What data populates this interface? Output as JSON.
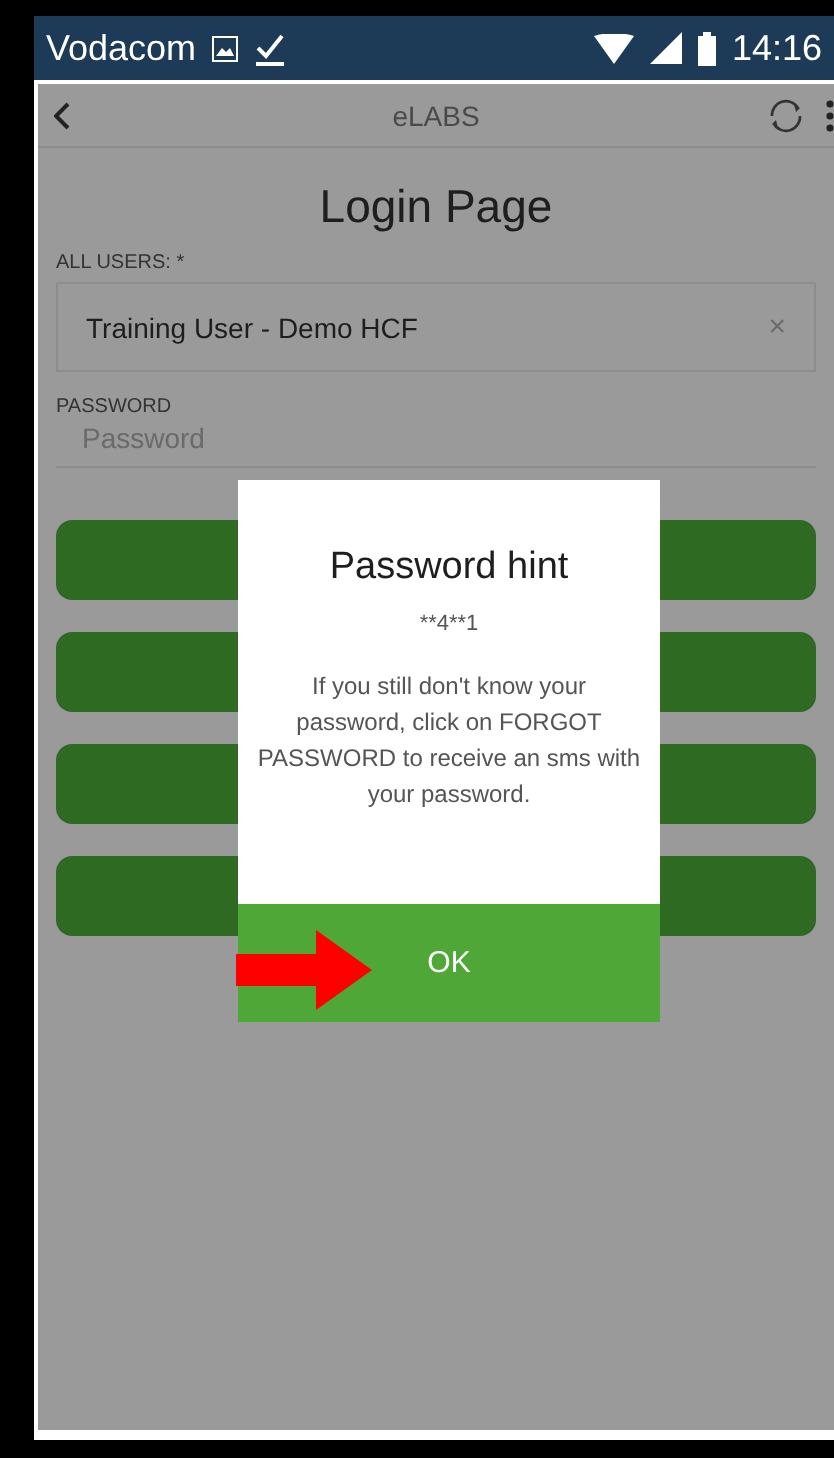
{
  "status_bar": {
    "carrier": "Vodacom",
    "time": "14:16"
  },
  "app_bar": {
    "title": "eLABS"
  },
  "heading": "Login Page",
  "users_field": {
    "label": "ALL USERS: *",
    "value": "Training User - Demo HCF",
    "clear": "×"
  },
  "password_field": {
    "label": "PASSWORD",
    "placeholder": "Password"
  },
  "action_buttons": [
    {
      "kind": "filled"
    },
    {
      "kind": "filled"
    },
    {
      "kind": "filled"
    },
    {
      "kind": "filled"
    }
  ],
  "dialog": {
    "title": "Password hint",
    "hint": "**4**1",
    "message": "If you still don't know your password, click on FORGOT PASSWORD to receive an sms with your password.",
    "ok_label": "OK"
  },
  "annotation_arrow": true
}
